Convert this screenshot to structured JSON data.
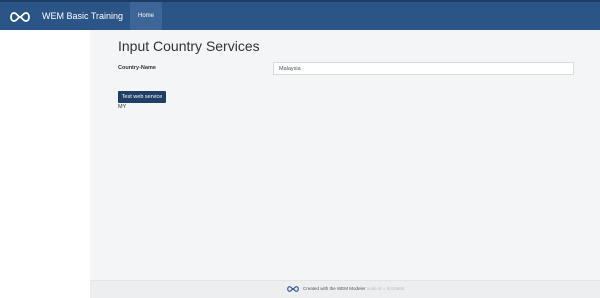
{
  "navbar": {
    "brand": "WEM Basic Training",
    "home_tab": "Home"
  },
  "page": {
    "title": "Input Country Services"
  },
  "form": {
    "country_label": "Country-Name",
    "country_value": "Malaysia"
  },
  "actions": {
    "test_button": "Test web service"
  },
  "result": {
    "text": "MY"
  },
  "footer": {
    "text": "Created with the WEM Modeler",
    "node": "node id = 8419859"
  },
  "colors": {
    "navbar": "#2b5487",
    "button": "#1f3f66",
    "background": "#f4f5f7"
  },
  "icons": {
    "logo": "wem-infinity-logo-icon"
  }
}
